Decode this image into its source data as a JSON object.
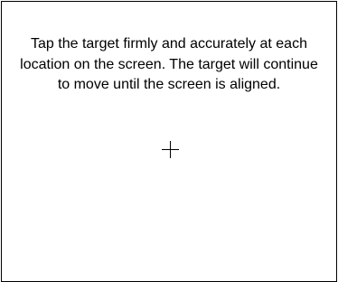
{
  "calibration": {
    "instruction_text": "Tap the target firmly and accurately at each location on the screen. The target will continue to move until the screen is aligned.",
    "target_icon": "crosshair-icon"
  }
}
